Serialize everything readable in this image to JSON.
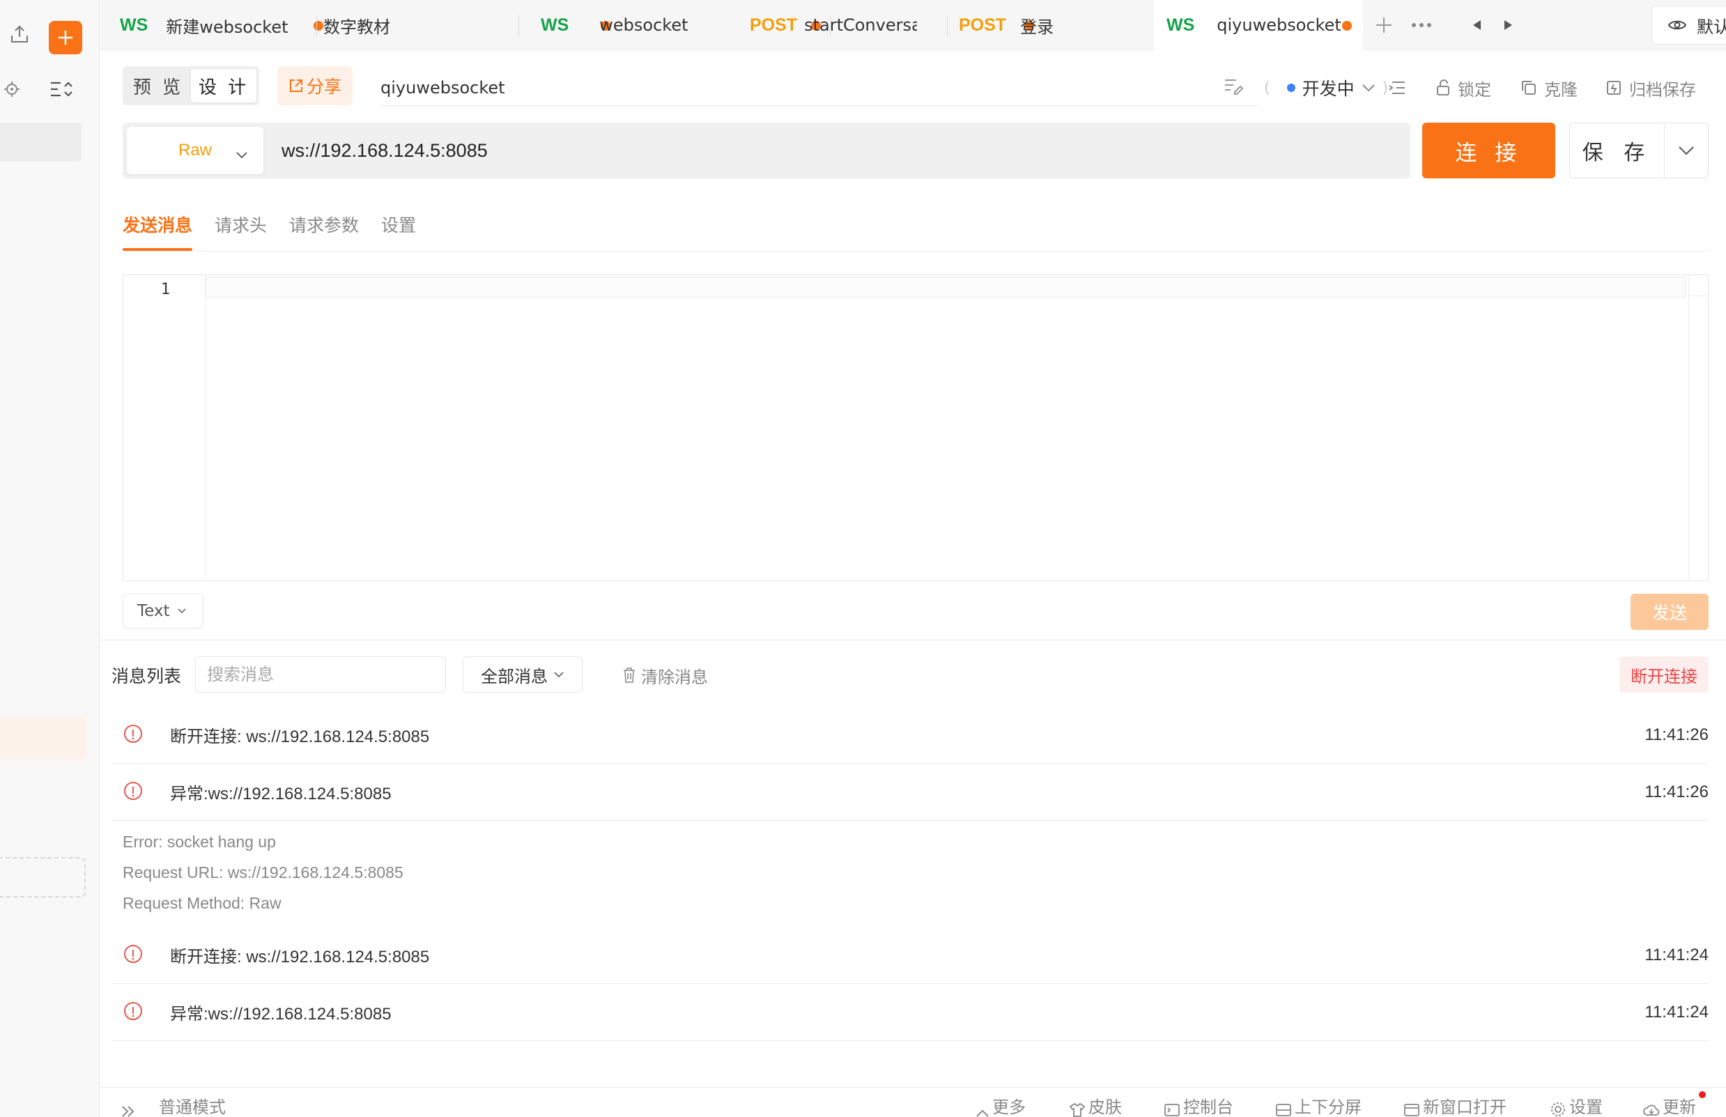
{
  "colors": {
    "accent": "#f97316",
    "ws": "#16a34a",
    "post": "#f59e0b",
    "danger": "#ef4444",
    "status_dot": "#3b82f6"
  },
  "tabs": [
    {
      "protocol": "WS",
      "name": "新建websocket",
      "unsaved": true
    },
    {
      "protocol": "",
      "name": "数字教材",
      "unsaved": true
    },
    {
      "protocol": "WS",
      "name": "websocket",
      "unsaved": true
    },
    {
      "protocol": "POST",
      "name": "startConversation",
      "unsaved": true
    },
    {
      "protocol": "POST",
      "name": "登录",
      "unsaved": false
    },
    {
      "protocol": "WS",
      "name": "qiyuwebsocket",
      "unsaved": true,
      "active": true
    }
  ],
  "environment": {
    "label": "默认环境"
  },
  "toolbar": {
    "preview": "预 览",
    "design": "设 计",
    "share": "分享",
    "request_name": "qiyuwebsocket",
    "status": "开发中",
    "lock": "锁定",
    "clone": "克隆",
    "archive": "归档保存"
  },
  "request": {
    "method": "Raw",
    "url": "ws://192.168.124.5:8085",
    "connect": "连 接",
    "save": "保 存"
  },
  "subtabs": [
    "发送消息",
    "请求头",
    "请求参数",
    "设置"
  ],
  "editor": {
    "line_number": "1",
    "content": ""
  },
  "composer": {
    "format": "Text",
    "send": "发送"
  },
  "messages": {
    "title": "消息列表",
    "search_placeholder": "搜索消息",
    "filter": "全部消息",
    "clear": "清除消息",
    "disconnect": "断开连接",
    "items": [
      {
        "text": "断开连接: ws://192.168.124.5:8085",
        "time": "11:41:26"
      },
      {
        "text": "异常:ws://192.168.124.5:8085",
        "time": "11:41:26"
      },
      {
        "text": "断开连接: ws://192.168.124.5:8085",
        "time": "11:41:24"
      },
      {
        "text": "异常:ws://192.168.124.5:8085",
        "time": "11:41:24"
      }
    ],
    "error_detail": [
      "Error: socket hang up",
      "Request URL: ws://192.168.124.5:8085",
      "Request Method: Raw"
    ]
  },
  "statusbar": {
    "mode": "普通模式",
    "more": "更多",
    "skin": "皮肤",
    "console": "控制台",
    "split": "上下分屏",
    "new_window": "新窗口打开",
    "settings": "设置",
    "update": "更新"
  }
}
